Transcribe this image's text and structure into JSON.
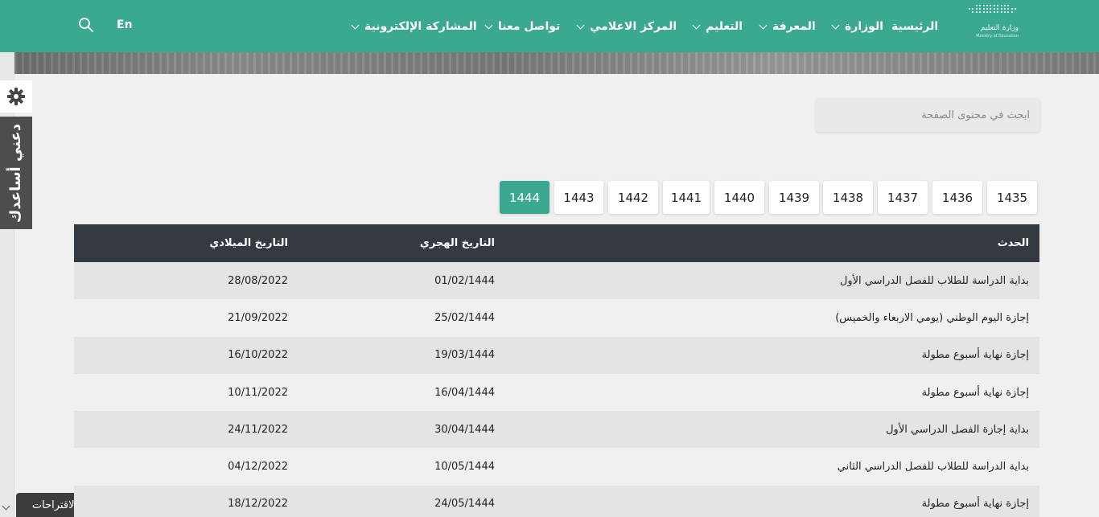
{
  "header": {
    "logo": {
      "text_ar": "وزارة التعليم",
      "text_en": "Ministry of Education"
    },
    "nav": [
      {
        "label": "الرئيسية",
        "has_dropdown": false
      },
      {
        "label": "الوزارة",
        "has_dropdown": true
      },
      {
        "label": "المعرفة",
        "has_dropdown": true
      },
      {
        "label": "التعليم",
        "has_dropdown": true
      },
      {
        "label": "المركز الاعلامي",
        "has_dropdown": true
      },
      {
        "label": "تواصل معنا",
        "has_dropdown": true
      },
      {
        "label": "المشاركة الإلكترونية",
        "has_dropdown": true
      }
    ],
    "language_label": "En",
    "search_icon": "search-icon"
  },
  "sidebar": {
    "settings_icon": "gear-icon",
    "help_label": "دعني أساعدك",
    "suggestions_label": "الاقتراحات"
  },
  "page_search": {
    "placeholder": "ابحث في محتوى الصفحة"
  },
  "years": {
    "items": [
      "1435",
      "1436",
      "1437",
      "1438",
      "1439",
      "1440",
      "1441",
      "1442",
      "1443",
      "1444"
    ],
    "selected": "1444"
  },
  "table": {
    "headers": {
      "event": "الحدث",
      "hijri": "التاريخ الهجري",
      "gregorian": "التاريخ الميلادي"
    },
    "rows": [
      {
        "event": "بداية الدراسة للطلاب للفصل الدراسي الأول",
        "hijri": "01/02/1444",
        "gregorian": "28/08/2022"
      },
      {
        "event": "إجازة اليوم الوطني (يومي الاربعاء والخميس)",
        "hijri": "25/02/1444",
        "gregorian": "21/09/2022"
      },
      {
        "event": "إجازة نهاية أسبوع مطولة",
        "hijri": "19/03/1444",
        "gregorian": "16/10/2022"
      },
      {
        "event": "إجازة نهاية أسبوع مطولة",
        "hijri": "16/04/1444",
        "gregorian": "10/11/2022"
      },
      {
        "event": "بداية إجازة الفصل الدراسي الأول",
        "hijri": "30/04/1444",
        "gregorian": "24/11/2022"
      },
      {
        "event": "بداية الدراسة للطلاب للفصل الدراسي الثاني",
        "hijri": "10/05/1444",
        "gregorian": "04/12/2022"
      },
      {
        "event": "إجازة نهاية أسبوع مطولة",
        "hijri": "24/05/1444",
        "gregorian": "18/12/2022"
      }
    ]
  },
  "colors": {
    "primary": "#3aa990",
    "table_header": "#353a40",
    "dark_tab": "#4d4d4d"
  }
}
